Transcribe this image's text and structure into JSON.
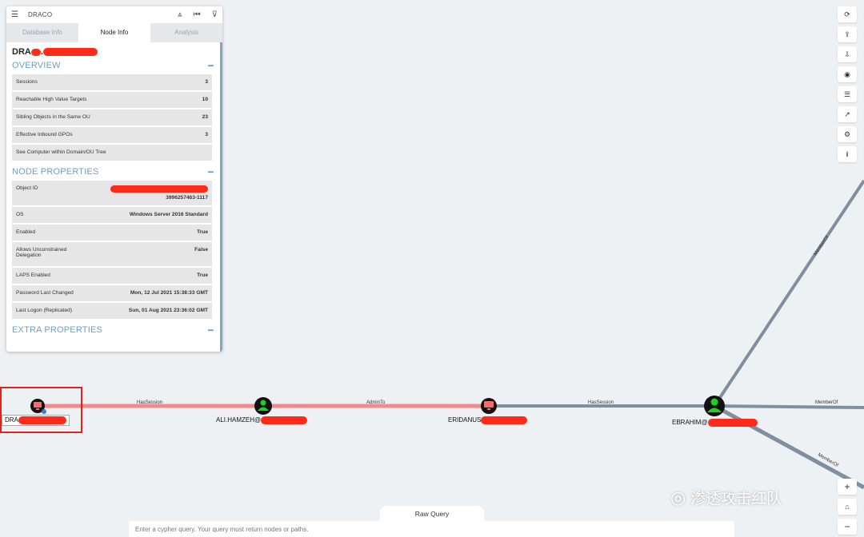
{
  "panel": {
    "header_title": "DRACO",
    "tabs": [
      "Database Info",
      "Node Info",
      "Analysis"
    ],
    "node_name": "DRA",
    "node_name_mid": ".",
    "overview_title": "OVERVIEW",
    "overview": [
      {
        "label": "Sessions",
        "value": "3"
      },
      {
        "label": "Reachable High Value Targets",
        "value": "10"
      },
      {
        "label": "Sibling Objects in the Same OU",
        "value": "23"
      },
      {
        "label": "Effective Inbound GPOs",
        "value": "3"
      },
      {
        "label": "See Computer within Domain/OU Tree",
        "value": ""
      }
    ],
    "node_props_title": "NODE PROPERTIES",
    "node_props": [
      {
        "label": "Object ID",
        "value": "3996257463-1117"
      },
      {
        "label": "OS",
        "value": "Windows Server 2016 Standard"
      },
      {
        "label": "Enabled",
        "value": "True"
      },
      {
        "label": "Allows Unconstrained Delegation",
        "value": "False"
      },
      {
        "label": "LAPS Enabled",
        "value": "True"
      },
      {
        "label": "Password Last Changed",
        "value": "Mon, 12 Jul 2021 15:38:33 GMT"
      },
      {
        "label": "Last Logon (Replicated)",
        "value": "Sun, 01 Aug 2021 23:36:02 GMT"
      }
    ],
    "extra_props_title": "EXTRA PROPERTIES"
  },
  "graph": {
    "nodes": [
      {
        "name": "dra-node",
        "kind": "computer",
        "label": "DRA"
      },
      {
        "name": "ali-node",
        "kind": "user",
        "label": "ALI.HAMZEH@"
      },
      {
        "name": "eridanus-node",
        "kind": "computer",
        "label": "ERIDANUS"
      },
      {
        "name": "ebrahim-node",
        "kind": "user",
        "label": "EBRAHIM@"
      }
    ],
    "edges": [
      "HasSession",
      "AdminTo",
      "HasSession",
      "MemberOf",
      "MemberOf",
      "MemberOf"
    ]
  },
  "toolbar": {
    "icons": [
      "refresh-icon",
      "upload-icon",
      "download-icon",
      "target-icon",
      "list-icon",
      "chart-icon",
      "settings-icon",
      "info-icon"
    ],
    "glyphs": [
      "⟳",
      "⇪",
      "⇩",
      "◉",
      "☰",
      "↗",
      "⚙",
      "i"
    ]
  },
  "zoom": {
    "glyphs": [
      "+",
      "⌂",
      "−"
    ]
  },
  "query": {
    "tab_label": "Raw Query",
    "placeholder": "Enter a cypher query. Your query must return nodes or paths."
  },
  "watermark": {
    "text": "渗透攻击红队"
  },
  "colors": {
    "accent": "#6d9fc3",
    "redaction": "#ff2a1a",
    "edge_red": "#f07070",
    "edge_gray": "#7a8a99",
    "user_node": "#1fd11f"
  }
}
